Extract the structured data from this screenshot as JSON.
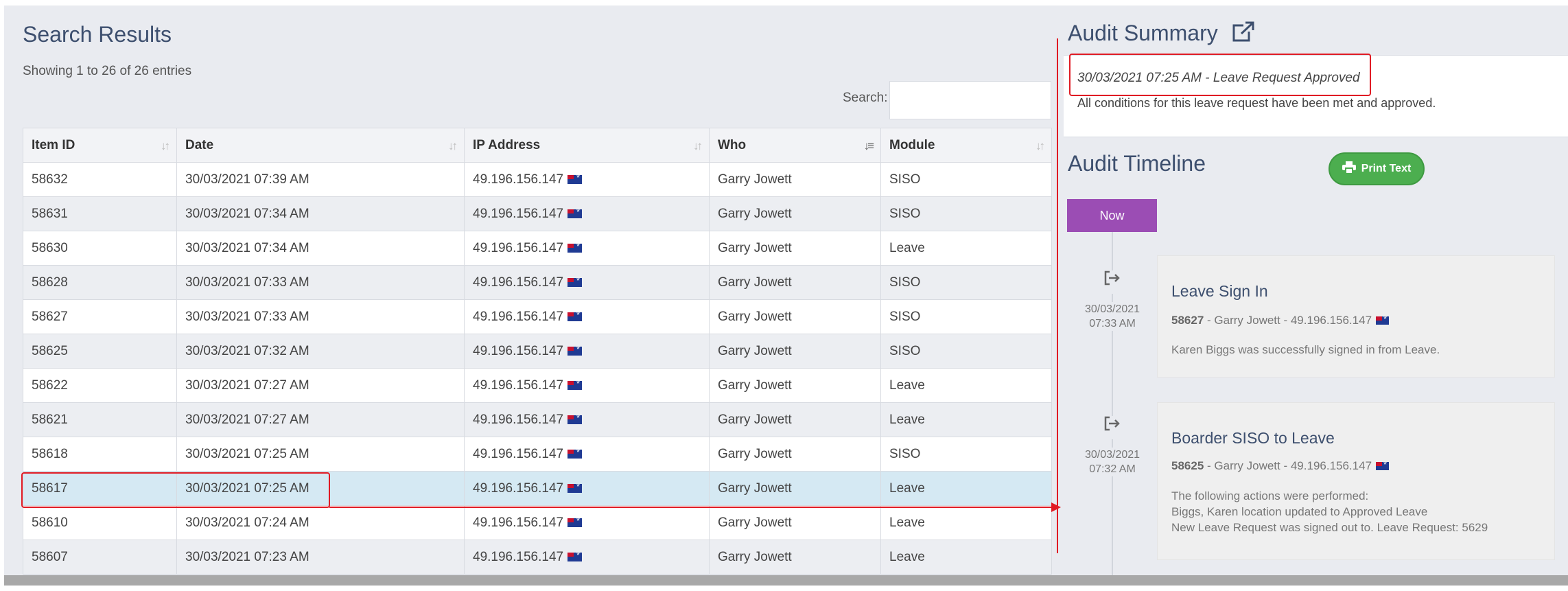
{
  "results": {
    "title": "Search Results",
    "entries_info": "Showing 1 to 26 of 26 entries",
    "search_label": "Search:",
    "search_value": "",
    "columns": [
      "Item ID",
      "Date",
      "IP Address",
      "Who",
      "Module"
    ],
    "rows": [
      {
        "id": "58632",
        "date": "30/03/2021 07:39 AM",
        "ip": "49.196.156.147",
        "who": "Garry Jowett",
        "module": "SISO"
      },
      {
        "id": "58631",
        "date": "30/03/2021 07:34 AM",
        "ip": "49.196.156.147",
        "who": "Garry Jowett",
        "module": "SISO"
      },
      {
        "id": "58630",
        "date": "30/03/2021 07:34 AM",
        "ip": "49.196.156.147",
        "who": "Garry Jowett",
        "module": "Leave"
      },
      {
        "id": "58628",
        "date": "30/03/2021 07:33 AM",
        "ip": "49.196.156.147",
        "who": "Garry Jowett",
        "module": "SISO"
      },
      {
        "id": "58627",
        "date": "30/03/2021 07:33 AM",
        "ip": "49.196.156.147",
        "who": "Garry Jowett",
        "module": "SISO"
      },
      {
        "id": "58625",
        "date": "30/03/2021 07:32 AM",
        "ip": "49.196.156.147",
        "who": "Garry Jowett",
        "module": "SISO"
      },
      {
        "id": "58622",
        "date": "30/03/2021 07:27 AM",
        "ip": "49.196.156.147",
        "who": "Garry Jowett",
        "module": "Leave"
      },
      {
        "id": "58621",
        "date": "30/03/2021 07:27 AM",
        "ip": "49.196.156.147",
        "who": "Garry Jowett",
        "module": "Leave"
      },
      {
        "id": "58618",
        "date": "30/03/2021 07:25 AM",
        "ip": "49.196.156.147",
        "who": "Garry Jowett",
        "module": "SISO"
      },
      {
        "id": "58617",
        "date": "30/03/2021 07:25 AM",
        "ip": "49.196.156.147",
        "who": "Garry Jowett",
        "module": "Leave"
      },
      {
        "id": "58610",
        "date": "30/03/2021 07:24 AM",
        "ip": "49.196.156.147",
        "who": "Garry Jowett",
        "module": "Leave"
      },
      {
        "id": "58607",
        "date": "30/03/2021 07:23 AM",
        "ip": "49.196.156.147",
        "who": "Garry Jowett",
        "module": "Leave"
      }
    ],
    "selected_row_index": 9,
    "sorted_column": "Who",
    "flag_icon": "australia-flag-icon"
  },
  "audit": {
    "summary_title": "Audit Summary",
    "summary_heading": "30/03/2021 07:25 AM - Leave Request Approved",
    "summary_body": "All conditions for this leave request have been met and approved.",
    "timeline_title": "Audit Timeline",
    "print_label": "Print Text",
    "now_label": "Now",
    "entries": [
      {
        "date": "30/03/2021",
        "time": "07:33 AM",
        "title": "Leave Sign In",
        "item_id": "58627",
        "meta": " - Garry Jowett - 49.196.156.147",
        "lines": [
          "Karen Biggs was successfully signed in from Leave."
        ]
      },
      {
        "date": "30/03/2021",
        "time": "07:32 AM",
        "title": "Boarder SISO to Leave",
        "item_id": "58625",
        "meta": " - Garry Jowett - 49.196.156.147",
        "lines": [
          "The following actions were performed:",
          "Biggs, Karen location updated to Approved Leave",
          "New Leave Request was signed out to. Leave Request: 5629"
        ]
      }
    ]
  },
  "colors": {
    "accent": "#3d4f6e",
    "now_badge": "#9b4db4",
    "print_button": "#4cae4f",
    "selected_row": "#d5e9f3",
    "annotation": "#e01b24"
  }
}
